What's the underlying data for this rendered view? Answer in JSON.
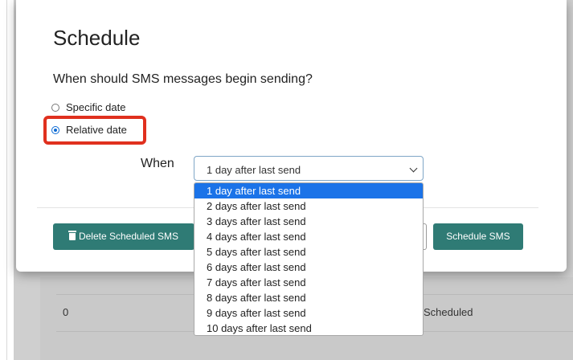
{
  "modal": {
    "title": "Schedule",
    "question": "When should SMS messages begin sending?",
    "radios": [
      {
        "label": "Specific date",
        "checked": false
      },
      {
        "label": "Relative date",
        "checked": true
      }
    ],
    "when_label": "When",
    "select_value": "1 day after last send",
    "options": [
      "1 day after last send",
      "2 days after last send",
      "3 days after last send",
      "4 days after last send",
      "5 days after last send",
      "6 days after last send",
      "7 days after last send",
      "8 days after last send",
      "9 days after last send",
      "10 days after last send"
    ],
    "delete_button": "Delete Scheduled SMS",
    "schedule_button": "Schedule SMS"
  },
  "background_table": {
    "cell_count": "0",
    "cell_status": "Scheduled"
  },
  "colors": {
    "accent": "#2f7b75",
    "highlight": "#e0301e",
    "selected_option": "#1b73e8"
  },
  "icons": {
    "delete": "trash-icon",
    "select": "chevron-down-icon"
  }
}
